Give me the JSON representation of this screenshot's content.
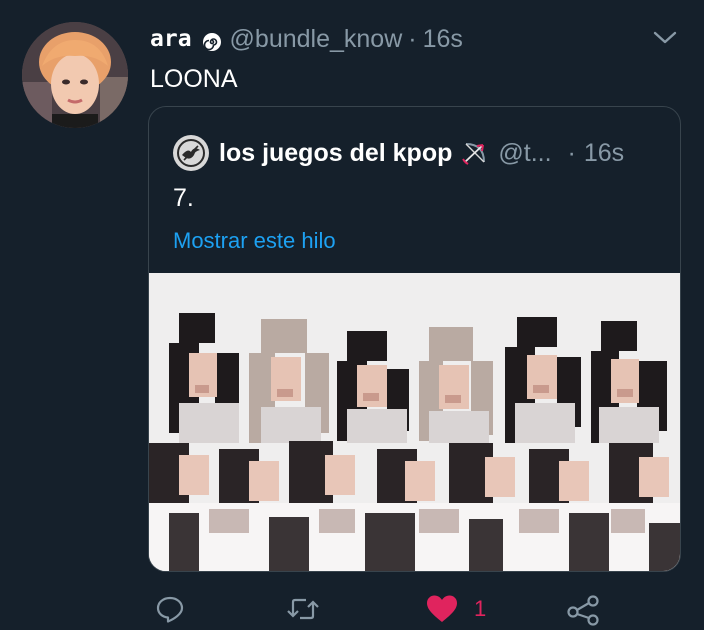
{
  "tweet": {
    "display_name": "ara",
    "handle": "@bundle_know",
    "separator": "·",
    "time": "16s",
    "text": "LOONA"
  },
  "quote": {
    "name": "los juegos del kpop",
    "handle": "@t...",
    "separator": "·",
    "time": "16s",
    "text": "7.",
    "show_thread_label": "Mostrar este hilo"
  },
  "actions": {
    "reply_icon": "reply-icon",
    "retweet_icon": "retweet-icon",
    "like_icon": "heart-icon",
    "like_count": "1",
    "share_icon": "share-icon"
  },
  "colors": {
    "background": "#15202b",
    "secondary_text": "#8899a6",
    "link": "#1da1f2",
    "like": "#e0245e",
    "border": "#38444d"
  }
}
